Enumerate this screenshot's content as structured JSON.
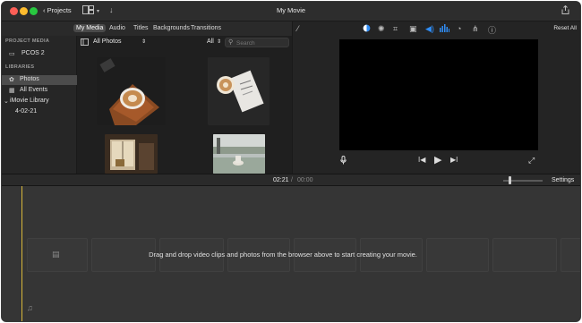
{
  "titlebar": {
    "projects_label": "‹ Projects",
    "window_title": "My Movie",
    "icons": [
      "layout-icon",
      "import-icon",
      "share-icon"
    ]
  },
  "tabs": [
    {
      "label": "My Media",
      "active": true
    },
    {
      "label": "Audio",
      "active": false
    },
    {
      "label": "Titles",
      "active": false
    },
    {
      "label": "Backgrounds",
      "active": false
    },
    {
      "label": "Transitions",
      "active": false
    }
  ],
  "sidebar": {
    "project_media_header": "PROJECT MEDIA",
    "project_item": "PCOS 2",
    "libraries_header": "LIBRARIES",
    "items": [
      {
        "label": "Photos",
        "selected": true
      },
      {
        "label": "All Events",
        "selected": false
      }
    ],
    "library_name": "iMovie Library",
    "event": "4-02-21"
  },
  "browser": {
    "source_select": "All Photos",
    "filter_select": "All",
    "search_placeholder": "Search"
  },
  "viewer_toolbar": {
    "reset_label": "Reset All",
    "icons": [
      "magic-wand-icon",
      "color-balance-icon",
      "color-correction-icon",
      "crop-icon",
      "stabilization-icon",
      "volume-icon",
      "equalizer-icon",
      "speed-icon",
      "noise-reduction-icon",
      "info-icon"
    ]
  },
  "timeline": {
    "current_time": "02:21",
    "separator": "/",
    "total_time": "00:00",
    "settings_label": "Settings",
    "empty_message": "Drag and drop video clips and photos from the browser above to start creating your movie."
  },
  "colors": {
    "accent_blue": "#2f8df6",
    "playhead_yellow": "#d8b73a",
    "selected_bg": "#4c4c4c"
  }
}
